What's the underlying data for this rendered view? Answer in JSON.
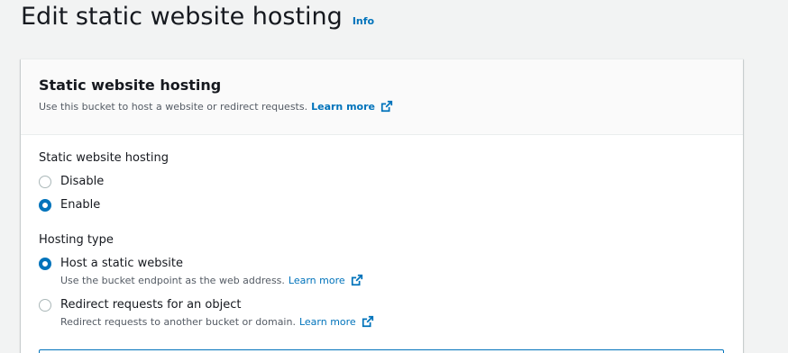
{
  "header": {
    "title": "Edit static website hosting",
    "info_label": "Info"
  },
  "panel": {
    "title": "Static website hosting",
    "description": "Use this bucket to host a website or redirect requests.",
    "learn_more": "Learn more"
  },
  "hosting": {
    "label": "Static website hosting",
    "options": [
      {
        "label": "Disable",
        "checked": false
      },
      {
        "label": "Enable",
        "checked": true
      }
    ]
  },
  "hosting_type": {
    "label": "Hosting type",
    "options": [
      {
        "label": "Host a static website",
        "description": "Use the bucket endpoint as the web address.",
        "learn_more": "Learn more",
        "checked": true
      },
      {
        "label": "Redirect requests for an object",
        "description": "Redirect requests to another bucket or domain.",
        "learn_more": "Learn more",
        "checked": false
      }
    ]
  },
  "colors": {
    "accent": "#0073bb",
    "background": "#f2f3f3",
    "text": "#16191f",
    "muted": "#545b64"
  },
  "icons": {
    "external_link": "external-link-icon"
  }
}
